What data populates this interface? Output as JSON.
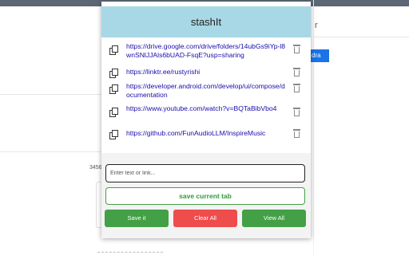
{
  "app": {
    "title": "stashIt"
  },
  "links": [
    {
      "url": "https://drive.google.com/drive/folders/14ubGs9iYp-l8wnSNlJJAls6bUAD-FsqE?usp=sharing"
    },
    {
      "url": "https://linktr.ee/rustyrishi"
    },
    {
      "url": "https://developer.android.com/develop/ui/compose/documentation"
    },
    {
      "url": "https://www.youtube.com/watch?v=BQTaBibVbo4"
    },
    {
      "url": "https://github.com/FunAudioLLM/InspireMusic"
    }
  ],
  "input": {
    "placeholder": "Enter text or link...",
    "value": ""
  },
  "buttons": {
    "save_current_tab": "save current tab",
    "save_it": "Save it",
    "clear_all": "Clear All",
    "view_all": "View All"
  },
  "icons": {
    "copy": "copy-icon",
    "delete": "trash-icon"
  },
  "colors": {
    "header": "#a8d8e6",
    "green": "#43a047",
    "red": "#ef4c4c",
    "link": "#1a0dab"
  },
  "background": {
    "topbar_text": "··· y · ··· · · · · ·",
    "right_letter": "r",
    "right_button": "dra",
    "left_number": "3456"
  }
}
